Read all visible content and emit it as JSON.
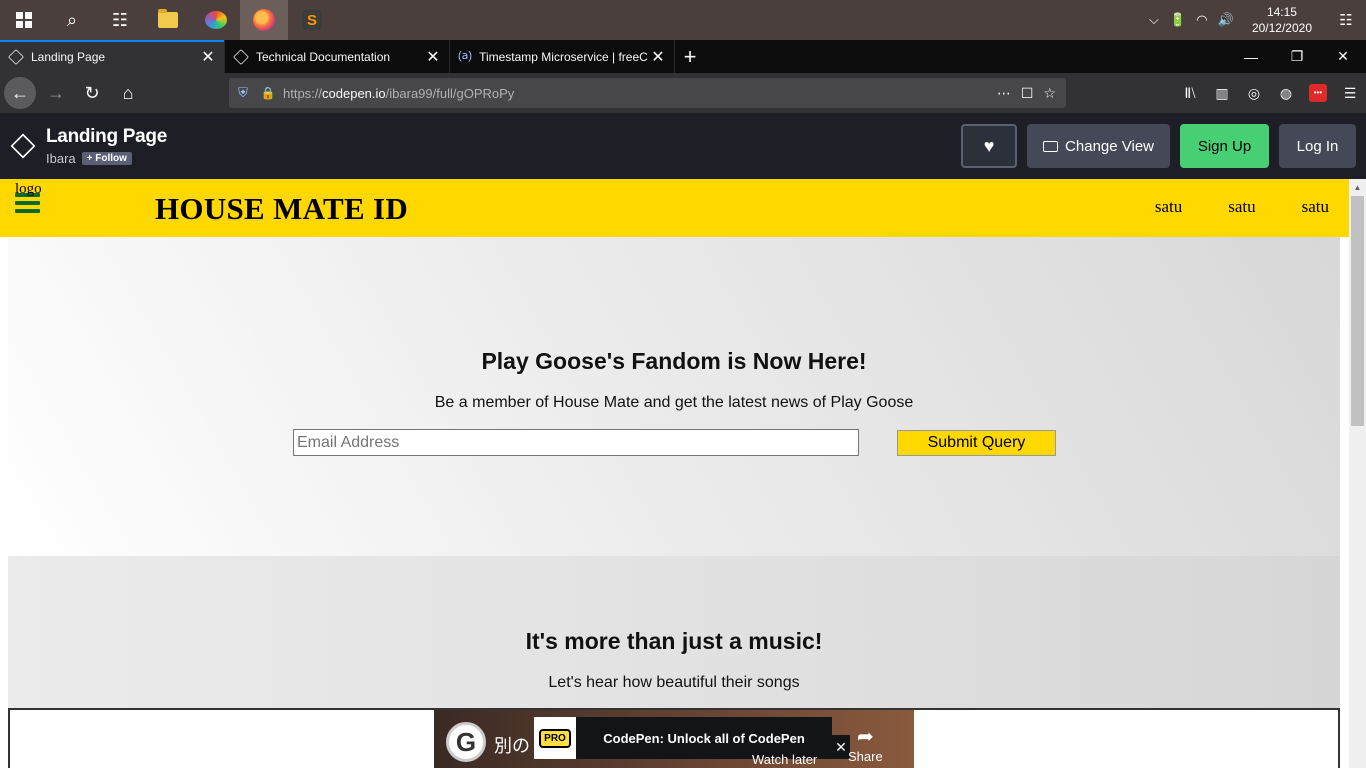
{
  "taskbar": {
    "clock_time": "14:15",
    "clock_date": "20/12/2020"
  },
  "browser": {
    "tabs": [
      {
        "title": "Landing Page"
      },
      {
        "title": "Technical Documentation"
      },
      {
        "title": "Timestamp Microservice | freeC"
      }
    ],
    "url_prefix": "https://",
    "url_host": "codepen.io",
    "url_path": "/ibara99/full/gOPRoPy"
  },
  "codepen": {
    "pen_title": "Landing Page",
    "author": "Ibara",
    "follow_label": "+ Follow",
    "change_view_label": "Change View",
    "signup_label": "Sign Up",
    "login_label": "Log In"
  },
  "site": {
    "logo_text": "logo",
    "brand": "HOUSE MATE ID",
    "nav": [
      "satu",
      "satu",
      "satu"
    ],
    "hero": {
      "heading": "Play Goose's Fandom is Now Here!",
      "subtext": "Be a member of House Mate and get the latest news of Play Goose",
      "email_placeholder": "Email Address",
      "submit_label": "Submit Query"
    },
    "music": {
      "heading": "It's more than just a music!",
      "subtext": "Let's hear how beautiful their songs"
    },
    "video": {
      "title_fragment": "別の",
      "pro_badge": "PRO",
      "ad_text": "CodePen: Unlock all of CodePen",
      "watch_later": "Watch later",
      "share": "Share"
    }
  },
  "colors": {
    "site_header_bg": "#ffd800",
    "signup_bg": "#47cf73",
    "codepen_header_bg": "#1e1f26"
  }
}
